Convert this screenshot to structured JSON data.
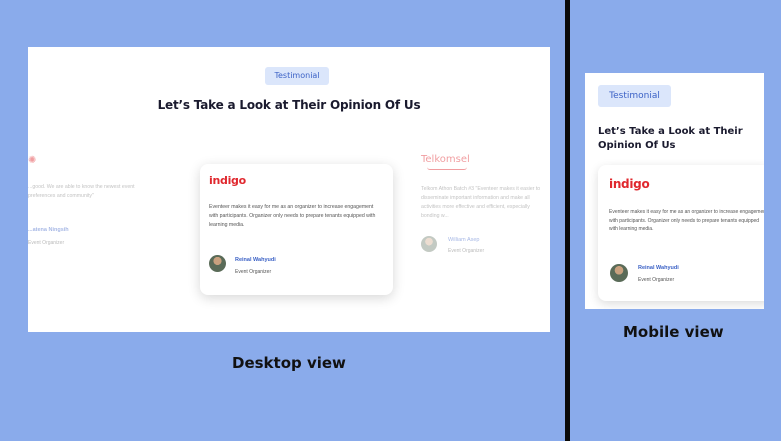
{
  "desktop": {
    "badge": "Testimonial",
    "title": "Let’s Take a Look at Their Opinion Of Us",
    "left_card": {
      "logo_glyph": "✺",
      "quote": "...good. We are able to know the newest event preferences and community\"",
      "person_name": "...atena Ningsih",
      "person_role": "Event Organizer"
    },
    "center_card": {
      "brand": "indigo",
      "quote": "Eventeer makes it easy for me as an organizer to increase engagement with participants. Organizer only needs to prepare tenants equipped with learning media.",
      "person_name": "Reinal Wahyudi",
      "person_role": "Event Organizer"
    },
    "right_card": {
      "brand": "Telkomsel",
      "quote": "Telkom Athon Batch #3 \"Eventeer makes it easier to disseminate important information and make all activities more effective and efficient, especially bonding w...",
      "person_name": "William Asep",
      "person_role": "Event Organizer"
    }
  },
  "mobile": {
    "badge": "Testimonial",
    "title": "Let’s Take a Look at Their Opinion Of Us",
    "card": {
      "brand": "indigo",
      "quote": "Eventeer makes it easy for me as an organizer to increase engagement with participants. Organizer only needs to prepare tenants equipped with learning media.",
      "person_name": "Reinal Wahyudi",
      "person_role": "Event Organizer"
    }
  },
  "captions": {
    "desktop": "Desktop view",
    "mobile": "Mobile view"
  },
  "colors": {
    "background": "#8aabeb",
    "accent_blue": "#3c62c6",
    "brand_red": "#e0282e"
  }
}
